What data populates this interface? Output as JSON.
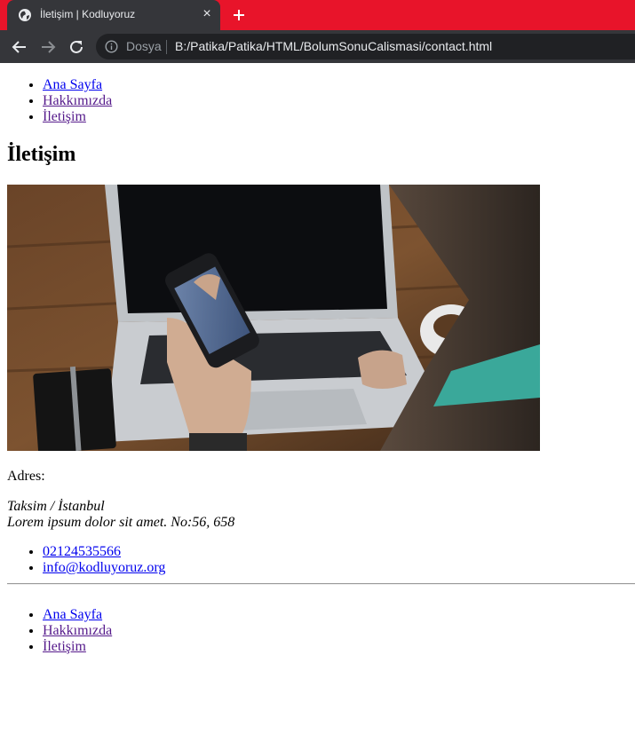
{
  "browser": {
    "tab_title": "İletişim | Kodluyoruz",
    "tab_close": "×",
    "scheme_label": "Dosya",
    "url": "B:/Patika/Patika/HTML/BolumSonuCalismasi/contact.html",
    "icons": [
      "globe-icon",
      "close-icon",
      "plus-icon",
      "back-arrow-icon",
      "forward-arrow-icon",
      "reload-icon",
      "info-icon"
    ],
    "colors": {
      "tabstrip": "#e8142a",
      "toolbar": "#35363a"
    }
  },
  "nav_top": [
    {
      "label": "Ana Sayfa",
      "visited": false
    },
    {
      "label": "Hakkımızda",
      "visited": true
    },
    {
      "label": "İletişim",
      "visited": true
    }
  ],
  "page_title": "İletişim",
  "hero_image": {
    "description_icon": "photo",
    "subject": "hand holding smartphone in front of laptop"
  },
  "address": {
    "label": "Adres:",
    "line1": "Taksim / İstanbul",
    "line2": "Lorem ipsum dolor sit amet. No:56, 658"
  },
  "contacts": [
    {
      "label": "02124535566"
    },
    {
      "label": "info@kodluyoruz.org"
    }
  ],
  "nav_bottom": [
    {
      "label": "Ana Sayfa",
      "visited": false
    },
    {
      "label": "Hakkımızda",
      "visited": true
    },
    {
      "label": "İletişim",
      "visited": true
    }
  ]
}
